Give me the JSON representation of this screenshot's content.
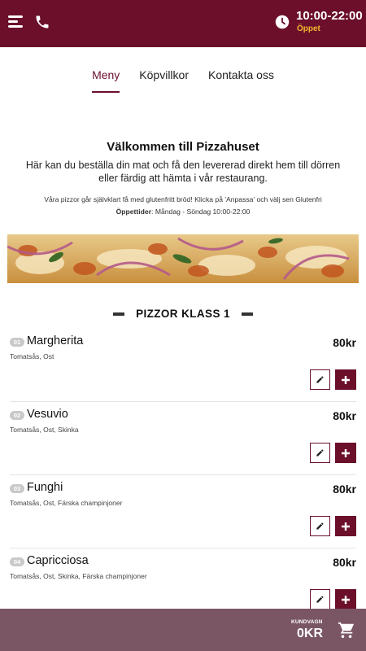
{
  "header": {
    "hours": "10:00-22:00",
    "status": "Öppet",
    "icons": [
      "menu-icon",
      "phone-icon",
      "clock-icon"
    ],
    "accent": "#6b0f2b",
    "status_color": "#f5b82e"
  },
  "nav": {
    "tabs": [
      {
        "label": "Meny",
        "active": true
      },
      {
        "label": "Köpvillkor",
        "active": false
      },
      {
        "label": "Kontakta oss",
        "active": false
      }
    ]
  },
  "welcome": {
    "title": "Välkommen till Pizzahuset",
    "lead": "Här kan du beställa din mat och få den levererad direkt hem till dörren eller färdig att hämta i vår restaurang.",
    "gluten_note": "Våra pizzor går självklart få med glutenfritt bröd! Klicka på 'Anpassa' och välj sen Glutenfri",
    "hours_label": "Öppettider",
    "hours_value": ": Måndag - Söndag 10:00-22:00"
  },
  "section": {
    "title": "PIZZOR KLASS 1"
  },
  "items": [
    {
      "num": "01",
      "name": "Margherita",
      "desc": "Tomatsås, Ost",
      "price": "80kr"
    },
    {
      "num": "02",
      "name": "Vesuvio",
      "desc": "Tomatsås, Ost, Skinka",
      "price": "80kr"
    },
    {
      "num": "03",
      "name": "Funghi",
      "desc": "Tomatsås, Ost, Färska champinjoner",
      "price": "80kr"
    },
    {
      "num": "04",
      "name": "Capricciosa",
      "desc": "Tomatsås, Ost, Skinka, Färska champinjoner",
      "price": "80kr"
    }
  ],
  "cart": {
    "label": "KUNDVAGN",
    "total": "0KR",
    "icon": "cart-icon",
    "bar_color": "#7a5665"
  }
}
